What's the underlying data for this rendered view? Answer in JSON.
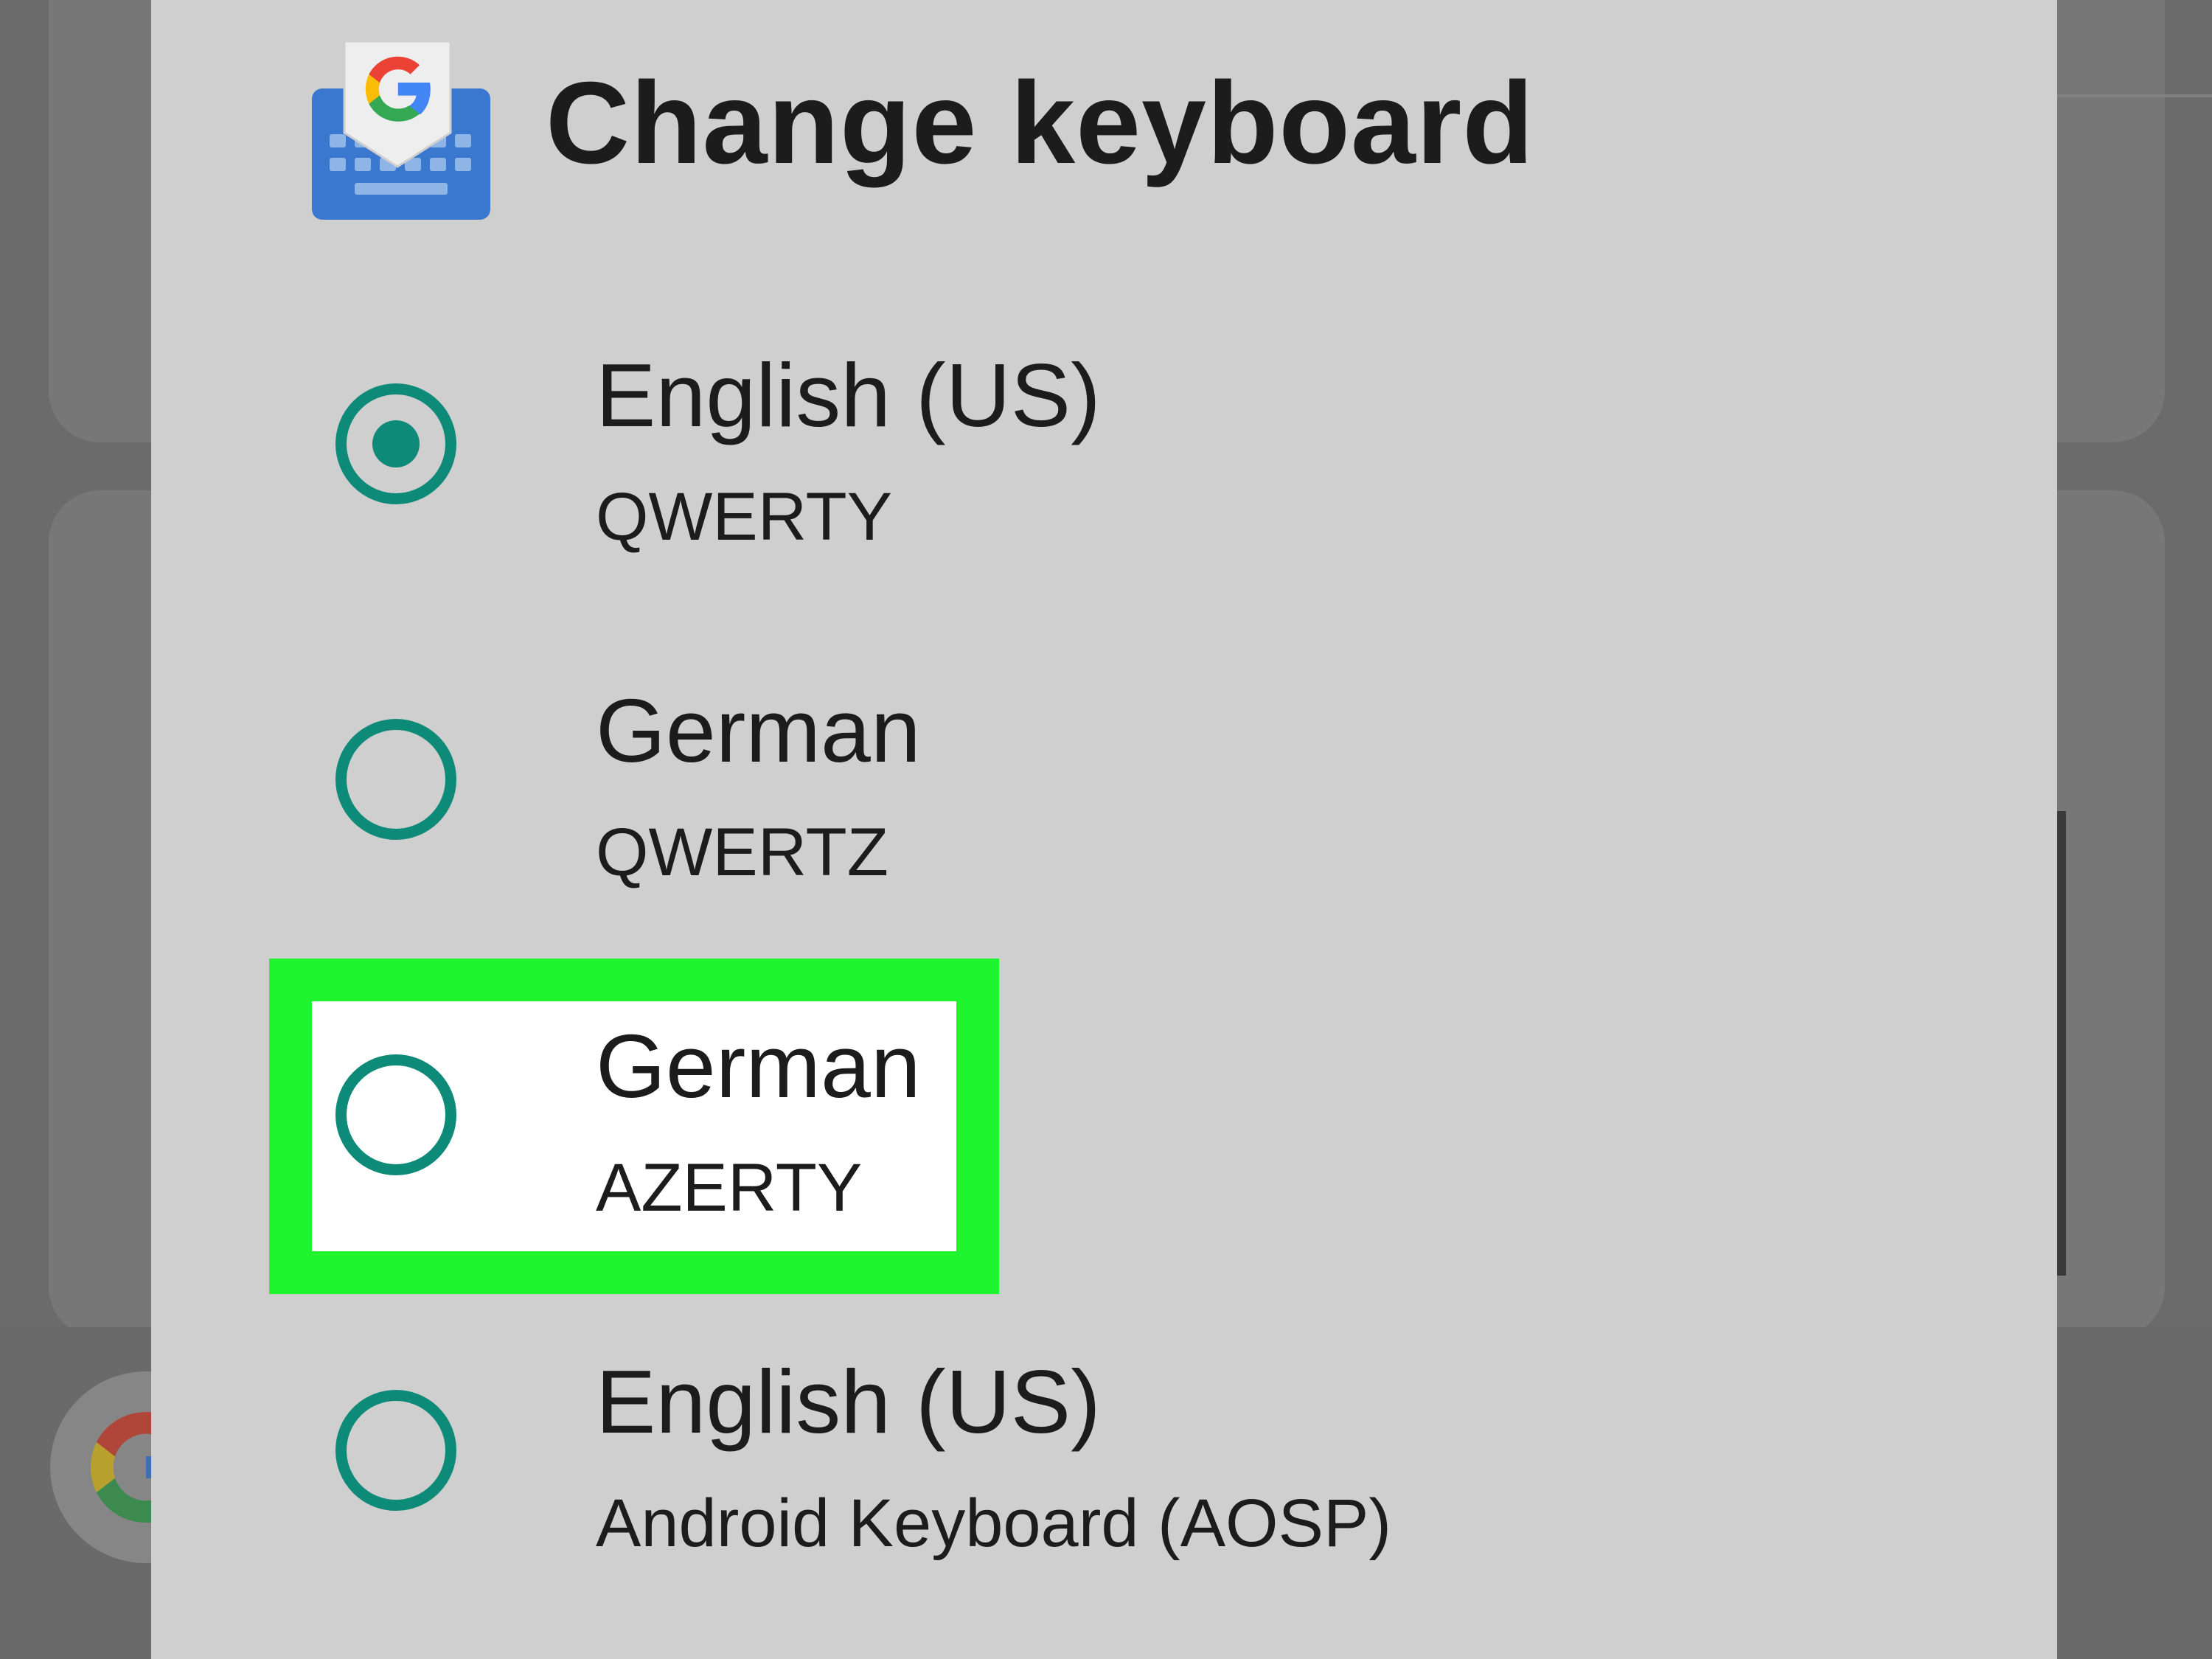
{
  "dialog": {
    "title": "Change keyboard",
    "icon": "gboard-icon"
  },
  "options": [
    {
      "language": "English (US)",
      "layout": "QWERTY",
      "selected": true
    },
    {
      "language": "German",
      "layout": "QWERTZ",
      "selected": false
    },
    {
      "language": "German",
      "layout": "AZERTY",
      "selected": false,
      "highlighted": true
    },
    {
      "language": "English (US)",
      "layout": "Android Keyboard (AOSP)",
      "selected": false
    }
  ],
  "colors": {
    "accent": "#0e8a78",
    "highlight": "#1ef52e",
    "dialog_bg": "#cfcfcf",
    "scrim": "#6b6b6b"
  }
}
